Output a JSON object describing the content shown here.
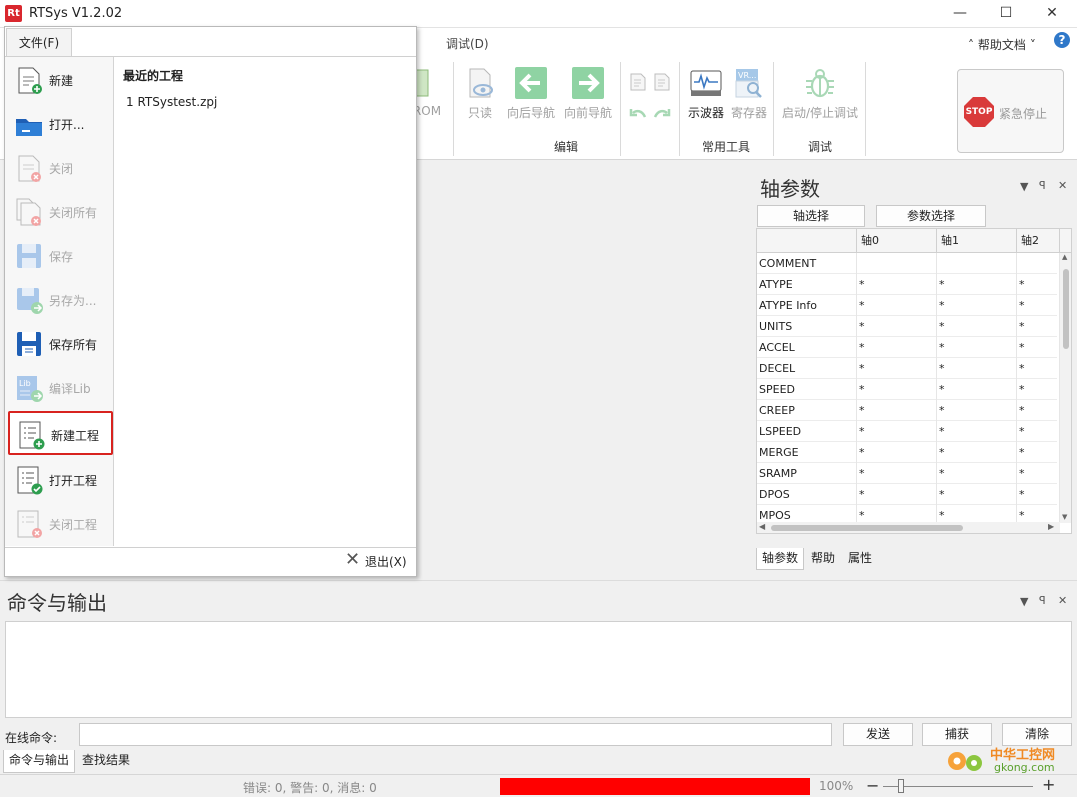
{
  "window": {
    "title": "RTSys V1.2.02",
    "logo_text": "Rt",
    "minimize": "—",
    "maximize": "☐",
    "close": "✕"
  },
  "ribbon": {
    "tab_debug": "调试(D)",
    "help_label": "帮助文档",
    "help_caret": "˅",
    "help_icon_glyph": "?",
    "partial_rom": "ROM",
    "buttons": {
      "readonly": "只读",
      "nav_back": "向后导航",
      "nav_forward": "向前导航",
      "oscilloscope": "示波器",
      "register": "寄存器",
      "start_stop_debug": "启动/停止调试",
      "emergency_stop": "紧急停止",
      "stop_sign_text": "STOP",
      "vr_badge": "VR..."
    },
    "groups": {
      "edit": "编辑",
      "common_tools": "常用工具",
      "debug": "调试"
    }
  },
  "file_menu": {
    "tab_label": "文件(F)",
    "items": [
      {
        "label": "新建",
        "enabled": true,
        "icon": "new-file-icon"
      },
      {
        "label": "打开...",
        "enabled": true,
        "icon": "open-folder-icon"
      },
      {
        "label": "关闭",
        "enabled": false,
        "icon": "close-file-icon"
      },
      {
        "label": "关闭所有",
        "enabled": false,
        "icon": "close-all-icon"
      },
      {
        "label": "保存",
        "enabled": false,
        "icon": "save-icon"
      },
      {
        "label": "另存为...",
        "enabled": false,
        "icon": "save-as-icon"
      },
      {
        "label": "保存所有",
        "enabled": true,
        "icon": "save-all-icon"
      },
      {
        "label": "编译Lib",
        "enabled": false,
        "icon": "compile-lib-icon"
      },
      {
        "label": "新建工程",
        "enabled": true,
        "icon": "new-project-icon",
        "highlighted": true
      },
      {
        "label": "打开工程",
        "enabled": true,
        "icon": "open-project-icon"
      },
      {
        "label": "关闭工程",
        "enabled": false,
        "icon": "close-project-icon"
      }
    ],
    "recent_title": "最近的工程",
    "recent_items": [
      "1 RTSystest.zpj"
    ],
    "exit_label": "退出(X)"
  },
  "axis_panel": {
    "title": "轴参数",
    "axis_select": "轴选择",
    "param_select": "参数选择",
    "columns": [
      "",
      "轴0",
      "轴1",
      "轴2"
    ],
    "rows": [
      [
        "COMMENT",
        "",
        "",
        ""
      ],
      [
        "ATYPE",
        "*",
        "*",
        "*"
      ],
      [
        "ATYPE Info",
        "*",
        "*",
        "*"
      ],
      [
        "UNITS",
        "*",
        "*",
        "*"
      ],
      [
        "ACCEL",
        "*",
        "*",
        "*"
      ],
      [
        "DECEL",
        "*",
        "*",
        "*"
      ],
      [
        "SPEED",
        "*",
        "*",
        "*"
      ],
      [
        "CREEP",
        "*",
        "*",
        "*"
      ],
      [
        "LSPEED",
        "*",
        "*",
        "*"
      ],
      [
        "MERGE",
        "*",
        "*",
        "*"
      ],
      [
        "SRAMP",
        "*",
        "*",
        "*"
      ],
      [
        "DPOS",
        "*",
        "*",
        "*"
      ],
      [
        "MPOS",
        "*",
        "*",
        "*"
      ]
    ],
    "tabs": [
      "轴参数",
      "帮助",
      "属性"
    ]
  },
  "cmd_panel": {
    "title": "命令与输出",
    "online_label": "在线命令:",
    "input_value": "",
    "send": "发送",
    "capture": "捕获",
    "clear": "清除",
    "tabs": [
      "命令与输出",
      "查找结果"
    ]
  },
  "status": {
    "text": "错误: 0, 警告: 0, 消息: 0",
    "zoom": "100%",
    "zoom_minus": "−",
    "zoom_plus": "+",
    "progress_color": "#ff0000"
  },
  "watermark": {
    "cn": "中华工控网",
    "url": "gkong.com"
  },
  "panel_glyphs": {
    "dropdown": "▼",
    "pin": "ꟼ",
    "close": "✕",
    "scroll_left": "◀",
    "scroll_right": "▶",
    "scroll_up": "▲",
    "scroll_down": "▼",
    "exit_x": "✕"
  }
}
